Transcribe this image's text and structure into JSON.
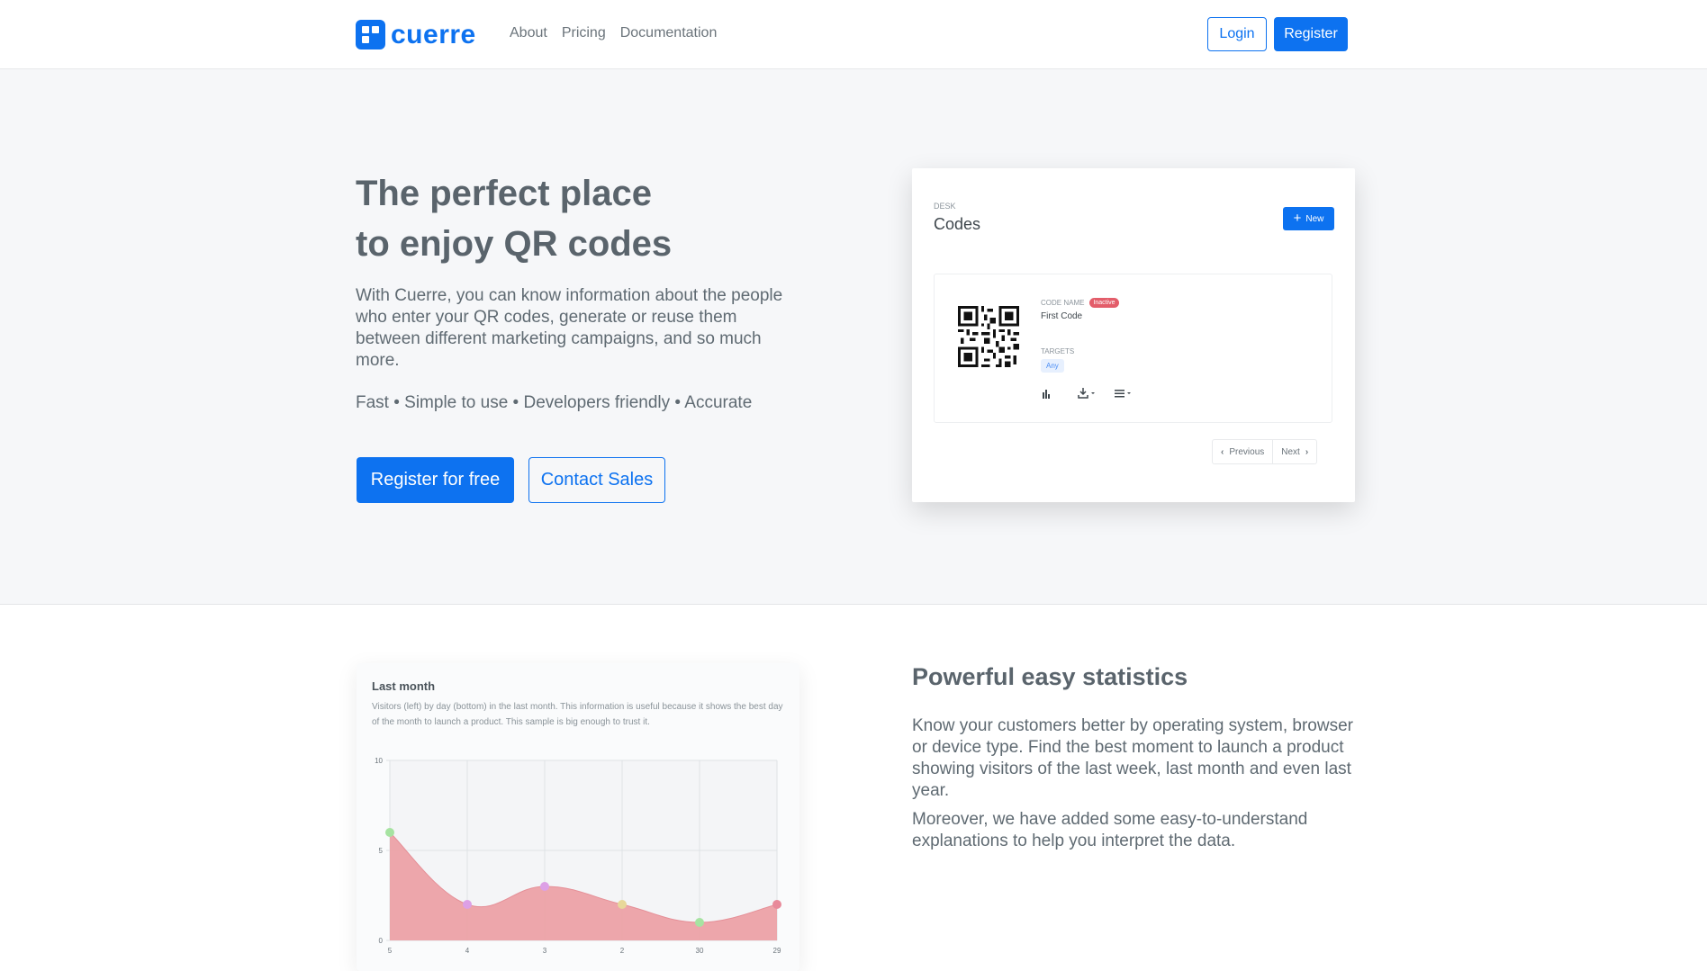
{
  "nav": {
    "brand": "cuerre",
    "links": [
      "About",
      "Pricing",
      "Documentation"
    ],
    "login_label": "Login",
    "register_label": "Register"
  },
  "hero": {
    "title_line1": "The perfect place",
    "title_line2": "to enjoy QR codes",
    "text": "With Cuerre, you can know information about the people who enter your QR codes, generate or reuse them between different marketing campaigns, and so much more.",
    "features": "Fast • Simple to use • Developers friendly • Accurate",
    "primary_cta": "Register for free",
    "secondary_cta": "Contact Sales"
  },
  "mock": {
    "eyebrow": "DESK",
    "title": "Codes",
    "new_label": "New",
    "code_name_label": "CODE NAME",
    "status_badge": "Inactive",
    "code_name": "First Code",
    "targets_label": "TARGETS",
    "target_badge": "Any",
    "prev_label": "Previous",
    "next_label": "Next",
    "icons": [
      "bar-chart-icon",
      "download-icon",
      "menu-icon"
    ]
  },
  "stats_chart": {
    "title": "Last month",
    "description": "Visitors (left) by day (bottom) in the last month. This information is useful because it shows the best day of the month to launch a product. This sample is big enough to trust it."
  },
  "chart_data": {
    "type": "area",
    "title": "Last month",
    "categories": [
      "5",
      "4",
      "3",
      "2",
      "30",
      "29"
    ],
    "series": [
      {
        "values": [
          6,
          2,
          3,
          2,
          1,
          2
        ]
      }
    ],
    "ylim": [
      0,
      10
    ],
    "yticks": [
      "0",
      "5",
      "10"
    ],
    "grid": true,
    "fill_color": "#eca1a6",
    "point_colors": [
      "#a6e3a1",
      "#dda0e6",
      "#dda0e6",
      "#e8d89a",
      "#a6e3a1",
      "#e88a9a"
    ]
  },
  "stats": {
    "title": "Powerful easy statistics",
    "p1": "Know your customers better by operating system, browser or device type. Find the best moment to launch a product showing visitors of the last week, last month and even last year.",
    "p2": "Moreover, we have added some easy-to-understand explanations to help you interpret the data."
  },
  "colors": {
    "accent": "#0d72f0",
    "text": "#5f6a72",
    "hero_bg": "#f6f7f9",
    "danger": "#e35d6a"
  }
}
